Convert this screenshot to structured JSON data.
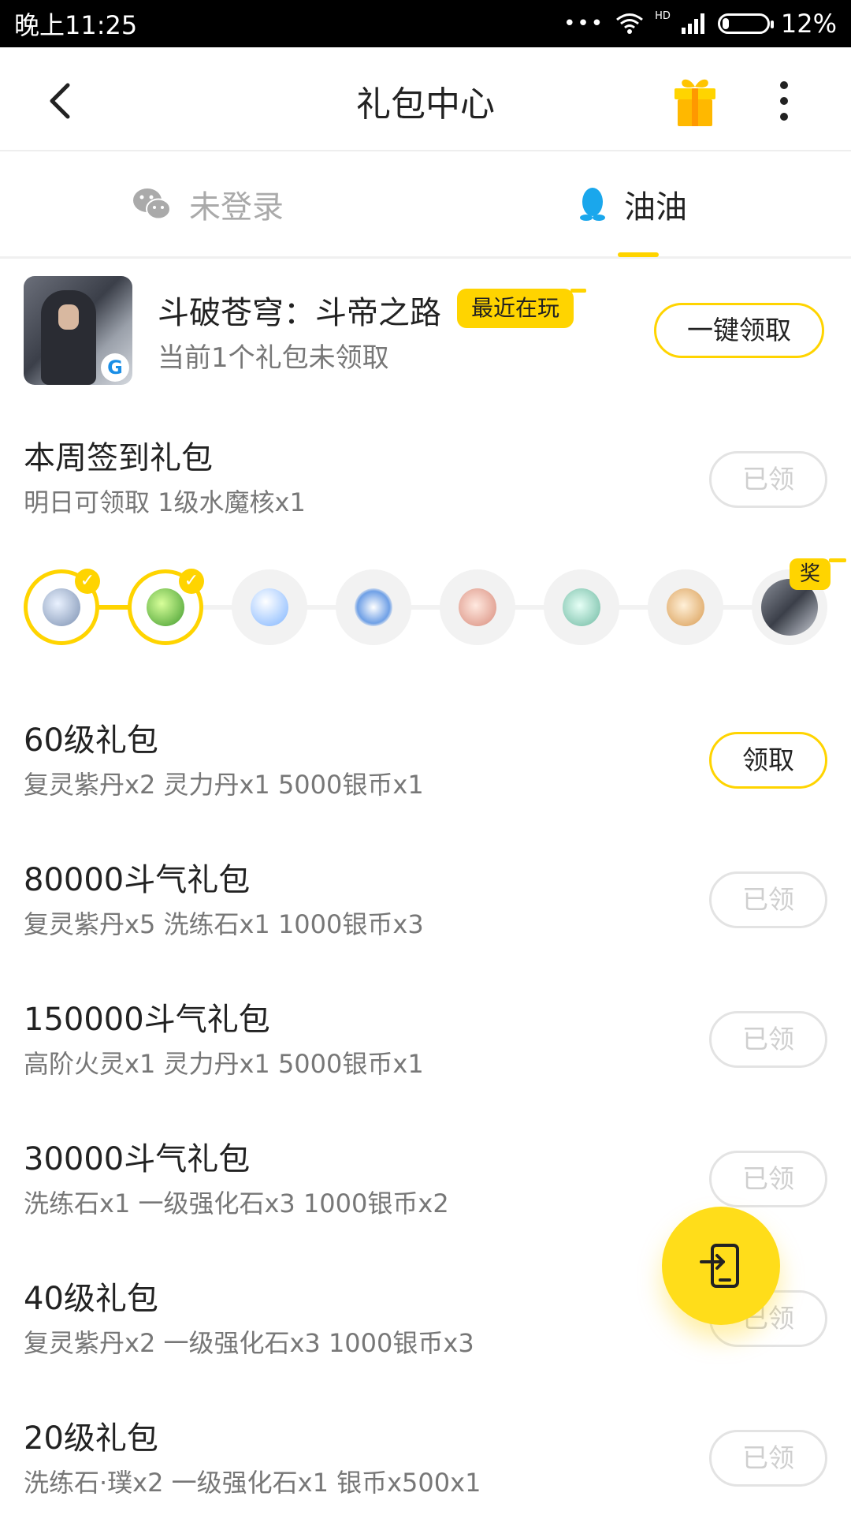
{
  "status_bar": {
    "time": "晚上11:25",
    "network": "HD",
    "battery": "12%",
    "battery_level": 0.12
  },
  "header": {
    "title": "礼包中心",
    "back_icon": "back-arrow-icon",
    "gift_icon": "gift-box-icon",
    "more_icon": "more-vertical-icon"
  },
  "accounts": {
    "wechat_label": "未登录",
    "qq_label": "油油",
    "active": "qq"
  },
  "game": {
    "name": "斗破苍穹：斗帝之路",
    "badge": "最近在玩",
    "subtitle": "当前1个礼包未领取",
    "claim_all_label": "一键领取"
  },
  "weekly_checkin": {
    "title": "本周签到礼包",
    "desc": "明日可领取 1级水魔核x1",
    "button": "已领",
    "reward_flag": "奖",
    "days_claimed": 2,
    "days_total": 8
  },
  "gifts": [
    {
      "title": "60级礼包",
      "desc": "复灵紫丹x2 灵力丹x1 5000银币x1",
      "button": "领取",
      "claimed": false
    },
    {
      "title": "80000斗气礼包",
      "desc": "复灵紫丹x5 洗练石x1 1000银币x3",
      "button": "已领",
      "claimed": true
    },
    {
      "title": "150000斗气礼包",
      "desc": "高阶火灵x1 灵力丹x1 5000银币x1",
      "button": "已领",
      "claimed": true
    },
    {
      "title": "30000斗气礼包",
      "desc": "洗练石x1 一级强化石x3 1000银币x2",
      "button": "已领",
      "claimed": true
    },
    {
      "title": "40级礼包",
      "desc": "复灵紫丹x2 一级强化石x3 1000银币x3",
      "button": "已领",
      "claimed": true
    },
    {
      "title": "20级礼包",
      "desc": "洗练石·璞x2 一级强化石x1 银币x500x1",
      "button": "已领",
      "claimed": true
    }
  ],
  "colors": {
    "accent": "#ffd400",
    "text": "#222222",
    "muted": "#777777",
    "disabled": "#cfcfcf"
  }
}
